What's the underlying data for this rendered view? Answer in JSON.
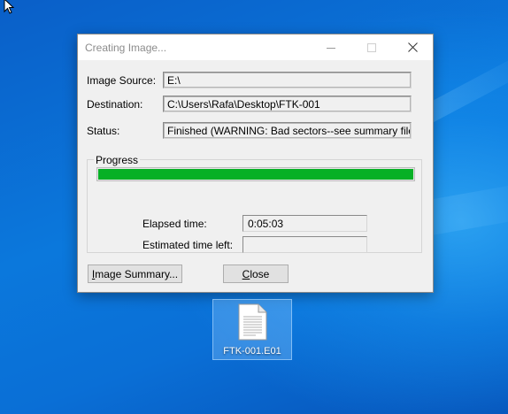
{
  "desktop": {
    "file_label": "FTK-001.E01"
  },
  "dialog": {
    "title": "Creating Image...",
    "fields": [
      {
        "label": "Image Source:",
        "value": "E:\\"
      },
      {
        "label": "Destination:",
        "value": "C:\\Users\\Rafa\\Desktop\\FTK-001"
      },
      {
        "label": "Status:",
        "value": "Finished (WARNING: Bad sectors--see summary file)"
      }
    ],
    "progress": {
      "group_label": "Progress",
      "fraction": 1.0,
      "color": "#06b025",
      "elapsed_label": "Elapsed time:",
      "elapsed_value": "0:05:03",
      "remaining_label": "Estimated time left:",
      "remaining_value": ""
    },
    "buttons": {
      "summary_label": "Image Summary...",
      "close_label": "Close"
    }
  }
}
